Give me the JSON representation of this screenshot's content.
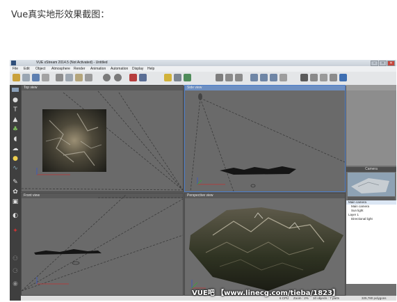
{
  "caption": "Vue真实地形效果截图：",
  "app": {
    "title": "VUE xStream 2014.5 (Not Activated) - Untitled",
    "menu": [
      "File",
      "Edit",
      "Object",
      "Atmosphere",
      "Render",
      "Animation",
      "Automation",
      "Display",
      "Help"
    ]
  },
  "viewports": {
    "top": "Top view",
    "side": "Side view",
    "front": "Front view",
    "perspective": "Perspective view"
  },
  "panel": {
    "camera_label": "Camera",
    "tree": [
      "Main camera",
      "Main camera",
      "Sun light",
      "Layer 1",
      "Directional light"
    ]
  },
  "status": {
    "fps": "6 CPU",
    "zoom": "Zoom : 2%",
    "objects": "10 objects : 7 parts",
    "polygons": "325,780 polygons"
  },
  "watermark": "VUE吧 【www.linecg.com/tieba/1823】"
}
